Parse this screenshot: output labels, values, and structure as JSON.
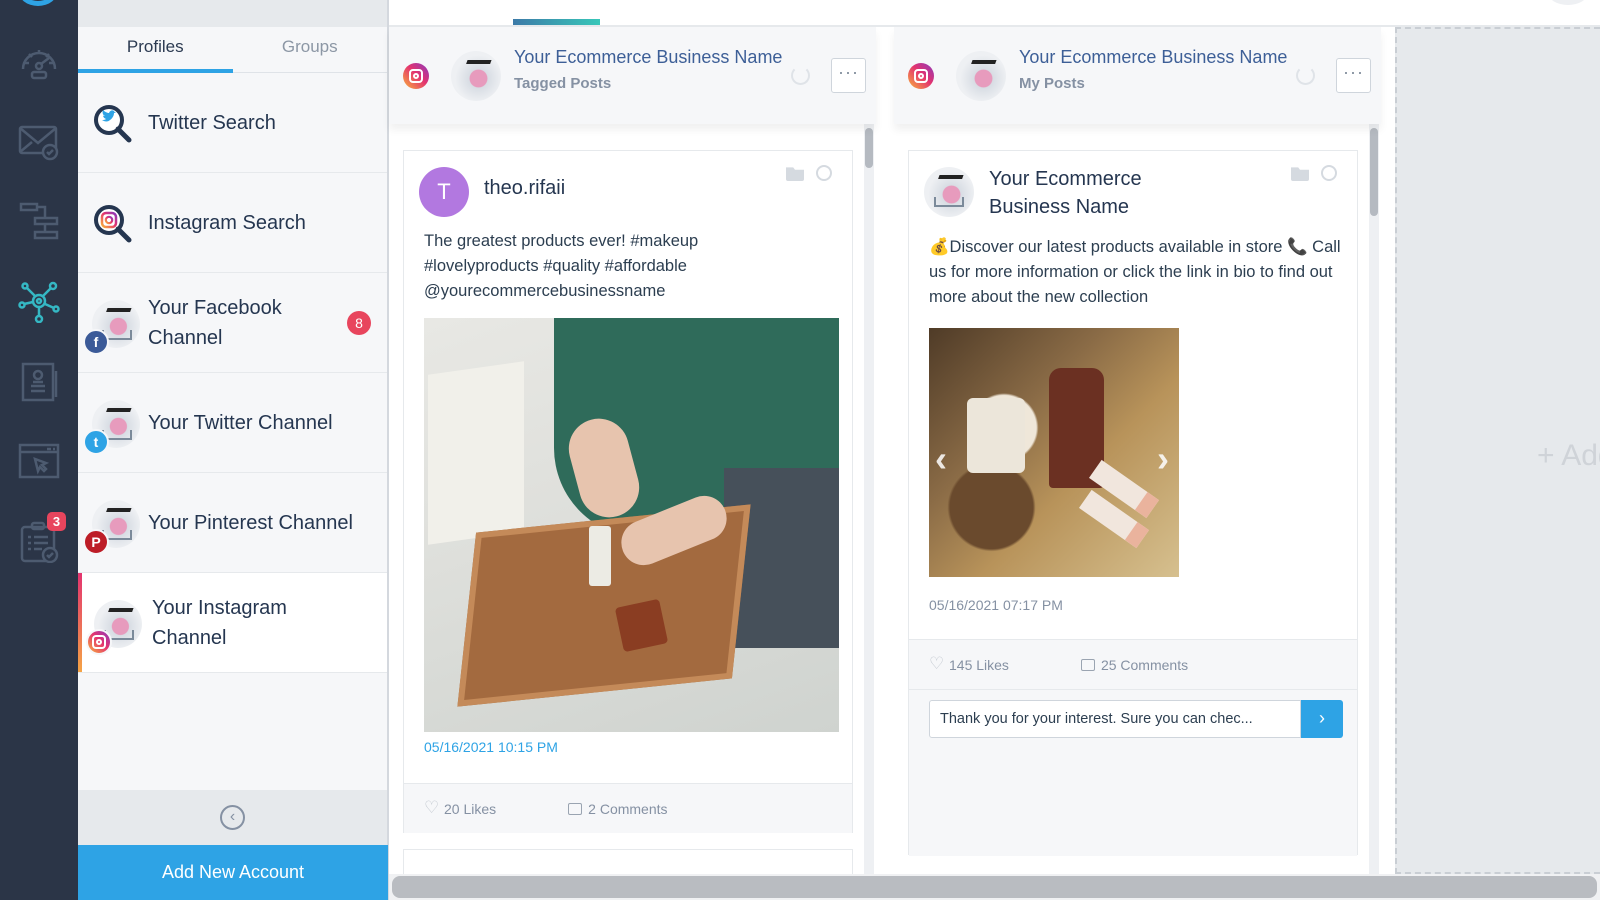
{
  "rail": {
    "items": [
      {
        "name": "dashboard",
        "icon": "speedometer-icon"
      },
      {
        "name": "inbox",
        "icon": "envelope-check-icon"
      },
      {
        "name": "workflow",
        "icon": "hierarchy-icon"
      },
      {
        "name": "social",
        "icon": "network-hub-icon",
        "active": true
      },
      {
        "name": "contacts",
        "icon": "contact-card-icon"
      },
      {
        "name": "web",
        "icon": "browser-cursor-icon"
      },
      {
        "name": "tasks",
        "icon": "clipboard-check-icon",
        "badge": "3"
      }
    ],
    "active_color": "#35b8c4",
    "icon_color": "#4d5b70"
  },
  "profiles": {
    "tabs": [
      {
        "label": "Profiles",
        "active": true
      },
      {
        "label": "Groups",
        "active": false
      }
    ],
    "items": [
      {
        "label": "Twitter Search",
        "kind": "search",
        "network": "twitter"
      },
      {
        "label": "Instagram Search",
        "kind": "search",
        "network": "instagram"
      },
      {
        "label": "Your Facebook Channel",
        "kind": "channel",
        "network": "facebook",
        "badge": "8"
      },
      {
        "label": "Your Twitter Channel",
        "kind": "channel",
        "network": "twitter"
      },
      {
        "label": "Your Pinterest Channel",
        "kind": "channel",
        "network": "pinterest"
      },
      {
        "label": "Your Instagram Channel",
        "kind": "channel",
        "network": "instagram",
        "active": true
      }
    ],
    "collapse_icon": "chevron-left-circle-icon",
    "add_account_label": "Add New Account"
  },
  "columns": [
    {
      "title": "Your Ecommerce Business Name",
      "subtitle": "Tagged Posts",
      "network": "instagram",
      "more_label": "···",
      "post": {
        "author_initial": "T",
        "author": "theo.rifaii",
        "text": "The greatest products ever! #makeup #lovelyproducts #quality #affordable @yourecommercebusinessname",
        "date": "05/16/2021 10:15 PM",
        "likes": "20 Likes",
        "comments": "2 Comments",
        "image_alt": "Hands applying serum over a wooden tray with a gift bag"
      }
    },
    {
      "title": "Your Ecommerce Business Name",
      "subtitle": "My Posts",
      "network": "instagram",
      "more_label": "···",
      "post": {
        "author": "Your Ecommerce Business Name",
        "text": "💰Discover our latest products available in store 📞 Call us for more information or click the link in bio to find out more about the new collection",
        "date": "05/16/2021 07:17 PM",
        "likes": "145 Likes",
        "comments": "25 Comments",
        "image_alt": "Cosmetics and candles on a gold tray",
        "carousel_prev": "‹",
        "carousel_next": "›",
        "reply_value": "Thank you for your interest. Sure you can chec...",
        "reply_send": "›"
      }
    }
  ],
  "add_stream_label": "+ Add"
}
